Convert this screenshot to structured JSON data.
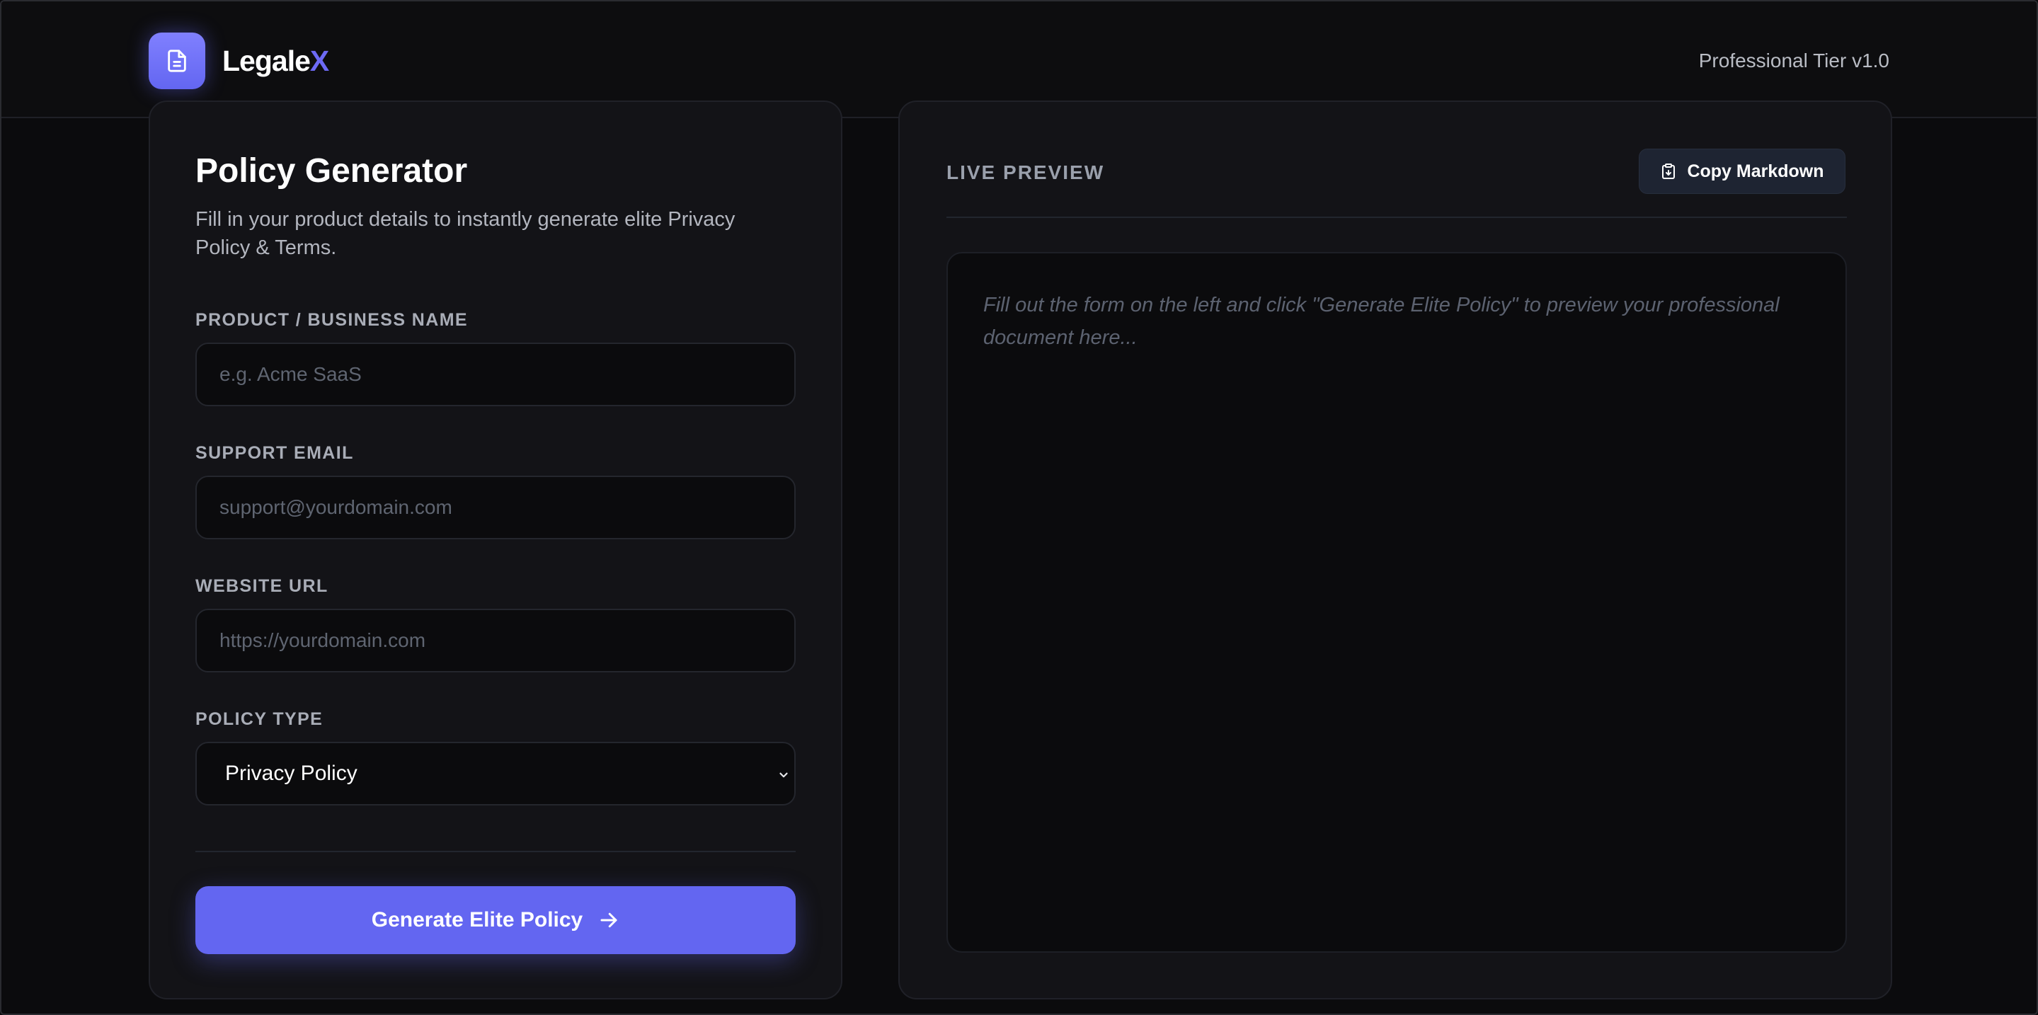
{
  "header": {
    "brand_main": "Legale",
    "brand_accent": "X",
    "tier": "Professional Tier v1.0",
    "logo_icon": "document-icon"
  },
  "form": {
    "title": "Policy Generator",
    "subtitle": "Fill in your product details to instantly generate elite Privacy Policy & Terms.",
    "fields": [
      {
        "label": "PRODUCT / BUSINESS NAME",
        "placeholder": "e.g. Acme SaaS",
        "value": ""
      },
      {
        "label": "SUPPORT EMAIL",
        "placeholder": "support@yourdomain.com",
        "value": ""
      },
      {
        "label": "WEBSITE URL",
        "placeholder": "https://yourdomain.com",
        "value": ""
      }
    ],
    "policy_type": {
      "label": "POLICY TYPE",
      "selected": "Privacy Policy"
    },
    "generate_label": "Generate Elite Policy",
    "generate_icon": "arrow-right-icon"
  },
  "preview": {
    "label": "LIVE PREVIEW",
    "copy_label": "Copy Markdown",
    "copy_icon": "clipboard-icon",
    "placeholder": "Fill out the form on the left and click \"Generate Elite Policy\" to preview your professional document here..."
  },
  "colors": {
    "accent": "#6366f1",
    "background": "#0b0b0d",
    "card": "#131317"
  }
}
